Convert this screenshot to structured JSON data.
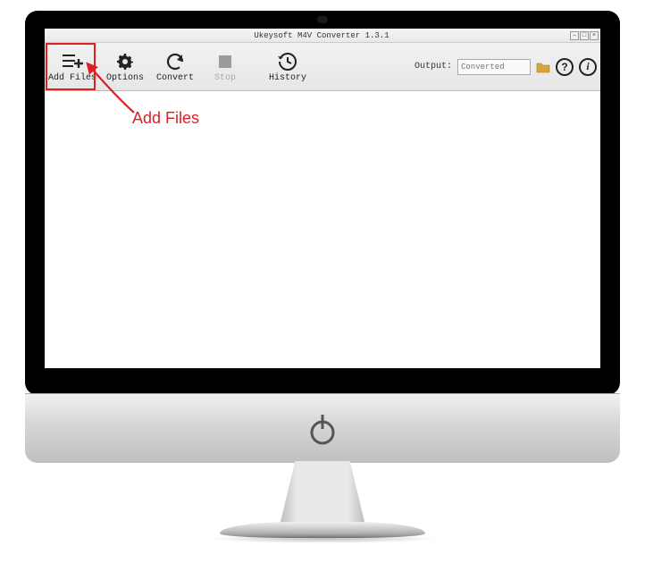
{
  "window": {
    "title": "Ukeysoft M4V Converter 1.3.1"
  },
  "toolbar": {
    "add_files": "Add Files",
    "options": "Options",
    "convert": "Convert",
    "stop": "Stop",
    "history": "History",
    "output_label": "Output:",
    "output_placeholder": "Converted",
    "help_symbol": "?",
    "info_symbol": "i"
  },
  "annotation": {
    "label": "Add Files"
  },
  "icons": {
    "add_files": "list-plus-icon",
    "options": "gear-icon",
    "convert": "refresh-icon",
    "stop": "stop-square-icon",
    "history": "history-clock-icon",
    "folder": "folder-icon",
    "help": "help-circle-icon",
    "info": "info-circle-icon"
  }
}
